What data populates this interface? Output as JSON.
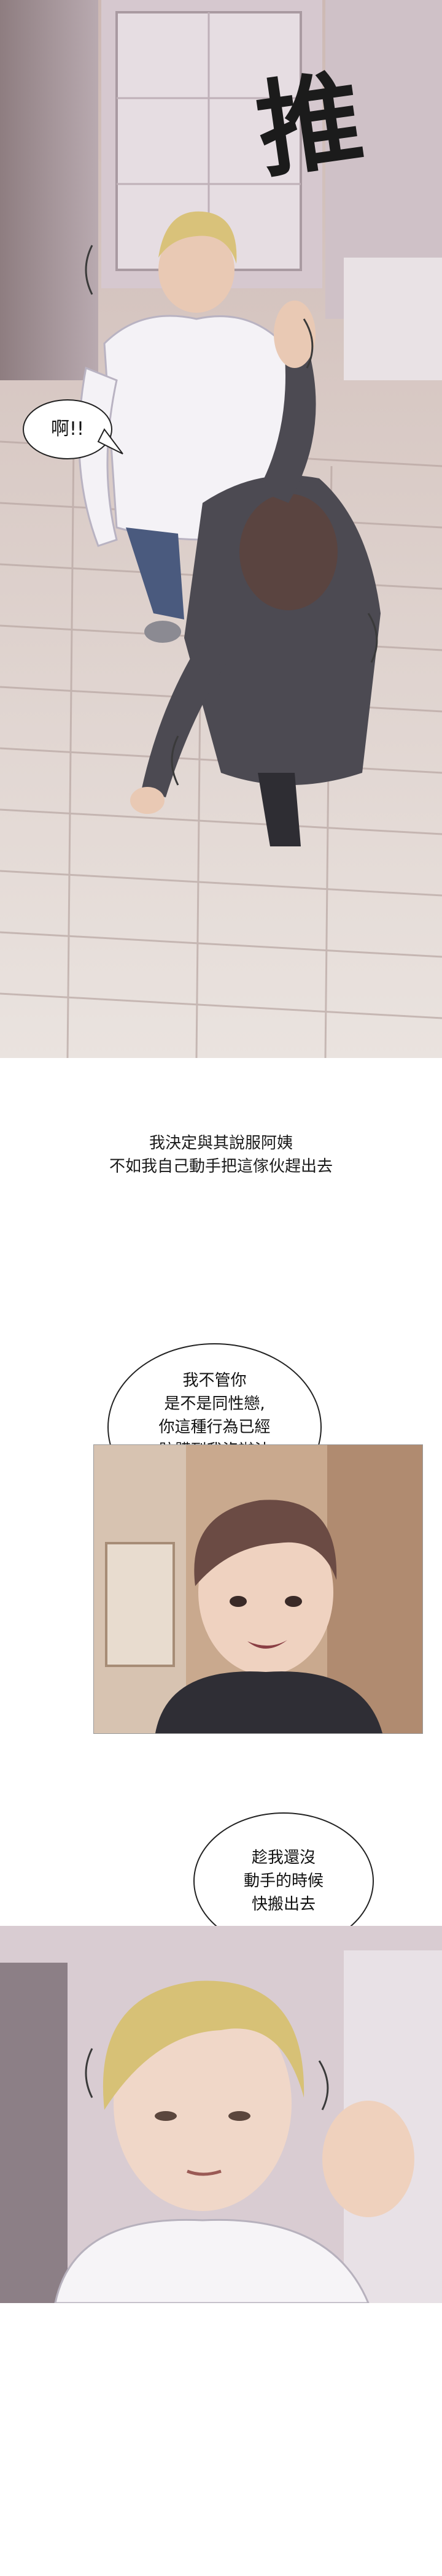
{
  "panel1": {
    "sfx": "推",
    "speech": "啊!!"
  },
  "narration": {
    "text": "我決定與其說服阿姨\n不如我自己動手把這傢伙趕出去"
  },
  "panel2": {
    "speech": "我不管你\n是不是同性戀,\n你這種行為已經\n骯髒到我沒辦法\n和你住在一起了"
  },
  "panel3": {
    "speech": "趁我還沒\n動手的時候\n快搬出去"
  }
}
